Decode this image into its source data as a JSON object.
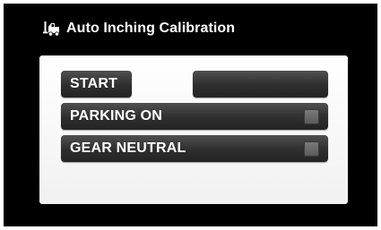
{
  "header": {
    "icon": "forklift-icon",
    "title": "Auto Inching Calibration"
  },
  "panel": {
    "start_label": "START",
    "status_display": "",
    "rows": [
      {
        "label": "PARKING ON",
        "indicator_state": "off"
      },
      {
        "label": "GEAR NEUTRAL",
        "indicator_state": "off"
      }
    ]
  },
  "colors": {
    "background": "#000000",
    "panel": "#ffffff",
    "button": "#2e2e2e",
    "indicator_off": "#6a6a6a"
  }
}
